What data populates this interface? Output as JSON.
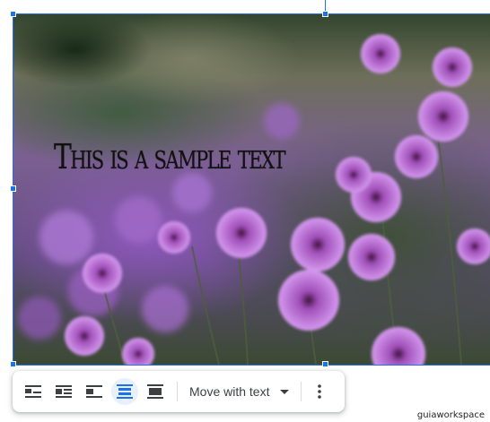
{
  "image": {
    "overlay_text": "This is a sample text",
    "subject": "purple-geranium-flowers"
  },
  "toolbar": {
    "wrap_options": [
      {
        "icon": "inline-icon",
        "active": false
      },
      {
        "icon": "wrap-text-icon",
        "active": false
      },
      {
        "icon": "break-text-icon",
        "active": false
      },
      {
        "icon": "behind-text-icon",
        "active": true
      },
      {
        "icon": "in-front-of-text-icon",
        "active": false
      }
    ],
    "position_select_value": "Move with text",
    "more_icon": "more-vert-icon"
  },
  "colors": {
    "selection": "#1a73e8",
    "active_bg": "#e8f0fe",
    "icon": "#3c4043"
  },
  "watermark": "guiaworkspace"
}
